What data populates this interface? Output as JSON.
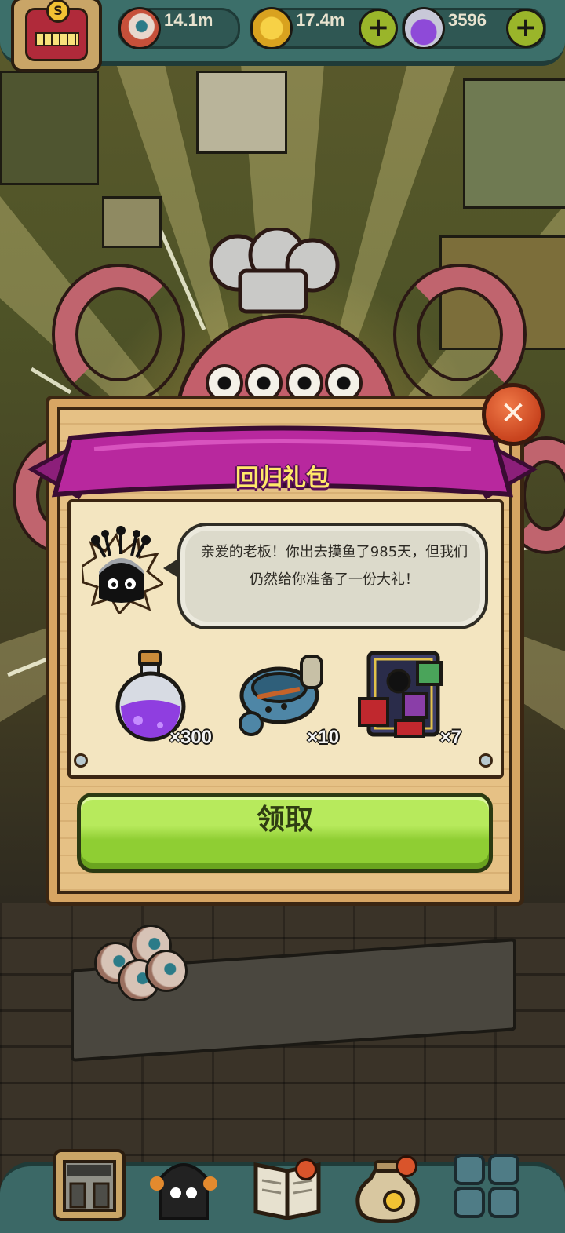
{
  "hud": {
    "eyeballs": "14.1m",
    "coins": "17.4m",
    "potions": "3596",
    "plus_symbol": "+"
  },
  "dialog": {
    "title": "回归礼包",
    "message": "亲爱的老板！你出去摸鱼了985天，但我们仍然给你准备了一份大礼！",
    "close_symbol": "✕",
    "rewards": [
      {
        "icon": "purple-potion-icon",
        "count": "×300"
      },
      {
        "icon": "treasure-bowl-icon",
        "count": "×10"
      },
      {
        "icon": "gift-card-icon",
        "count": "×7"
      }
    ],
    "claim_label": "领取"
  },
  "bottom_nav": [
    {
      "icon": "shop-building-icon"
    },
    {
      "icon": "monster-icon"
    },
    {
      "icon": "book-icon"
    },
    {
      "icon": "money-bag-icon"
    },
    {
      "icon": "grid-menu-icon"
    }
  ],
  "colors": {
    "banner": "#b8289e",
    "claim_button": "#9fd83c",
    "close_button": "#d9542b",
    "hud": "#3c6f6a"
  }
}
